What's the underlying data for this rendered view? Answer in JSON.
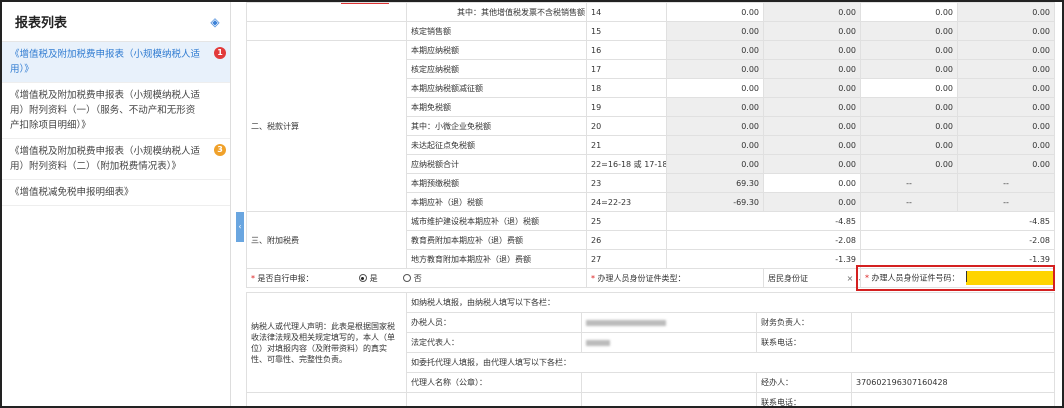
{
  "sidebar": {
    "title": "报表列表",
    "items": [
      {
        "label": "《增值税及附加税费申报表（小规模纳税人适用）》",
        "badge": "1",
        "active": true
      },
      {
        "label": "《增值税及附加税费申报表（小规模纳税人适用）附列资料（一）（服务、不动产和无形资产扣除项目明细）》",
        "badge": ""
      },
      {
        "label": "《增值税及附加税费申报表（小规模纳税人适用）附列资料（二）（附加税费情况表）》",
        "badge": "3"
      },
      {
        "label": "《增值税减免税申报明细表》",
        "badge": ""
      }
    ]
  },
  "table": {
    "section_tax": "二、税款计算",
    "section_surcharge": "三、附加税费",
    "rows": [
      {
        "name": "其中：其他增值税发票不含税销售额",
        "no": "14",
        "v1": "0.00",
        "v2": "0.00",
        "v3": "0.00",
        "v4": "0.00"
      },
      {
        "name": "核定销售额",
        "no": "15",
        "v1": "0.00",
        "v2": "0.00",
        "v3": "0.00",
        "v4": "0.00"
      },
      {
        "name": "本期应纳税额",
        "no": "16",
        "v1": "0.00",
        "v2": "0.00",
        "v3": "0.00",
        "v4": "0.00"
      },
      {
        "name": "核定应纳税额",
        "no": "17",
        "v1": "0.00",
        "v2": "0.00",
        "v3": "0.00",
        "v4": "0.00"
      },
      {
        "name": "本期应纳税额减征额",
        "no": "18",
        "v1": "0.00",
        "v2": "0.00",
        "v3": "0.00",
        "v4": "0.00"
      },
      {
        "name": "本期免税额",
        "no": "19",
        "v1": "0.00",
        "v2": "0.00",
        "v3": "0.00",
        "v4": "0.00"
      },
      {
        "name": "其中：小微企业免税额",
        "no": "20",
        "v1": "0.00",
        "v2": "0.00",
        "v3": "0.00",
        "v4": "0.00"
      },
      {
        "name": "未达起征点免税额",
        "no": "21",
        "v1": "0.00",
        "v2": "0.00",
        "v3": "0.00",
        "v4": "0.00"
      },
      {
        "name": "应纳税额合计",
        "no": "22=16-18 或 17-18",
        "v1": "0.00",
        "v2": "0.00",
        "v3": "0.00",
        "v4": "0.00"
      },
      {
        "name": "本期预缴税额",
        "no": "23",
        "v1": "69.30",
        "v2": "0.00",
        "v3": "--",
        "v4": "--"
      },
      {
        "name": "本期应补（退）税额",
        "no": "24=22-23",
        "v1": "-69.30",
        "v2": "0.00",
        "v3": "--",
        "v4": "--"
      }
    ],
    "surcharge_rows": [
      {
        "name": "城市维护建设税本期应补（退）税额",
        "no": "25",
        "v_left": "-4.85",
        "v_right": "-4.85"
      },
      {
        "name": "教育费附加本期应补（退）费额",
        "no": "26",
        "v_left": "-2.08",
        "v_right": "-2.08"
      },
      {
        "name": "地方教育附加本期应补（退）费额",
        "no": "27",
        "v_left": "-1.39",
        "v_right": "-1.39"
      }
    ]
  },
  "self_declare": {
    "label": "是否自行申报：",
    "yes": "是",
    "no": "否",
    "id_type_label": "办理人员身份证件类型：",
    "id_type_value": "居民身份证",
    "id_no_label": "办理人员身份证件号码："
  },
  "declaration": {
    "note": "纳税人或代理人声明：此表是根据国家税收法律法规及相关规定填写的，本人（单位）对填报内容（及附带资料）的真实性、可靠性、完整性负责。",
    "taxpayer_fill": "如纳税人填报，由纳税人填写以下各栏：",
    "handler": "办税人员：",
    "finance_head": "财务负责人：",
    "legal_rep": "法定代表人：",
    "phone": "联系电话：",
    "agent_fill": "如委托代理人填报，由代理人填写以下各栏：",
    "agent_name": "代理人名称（公章）：",
    "operator": "经办人：",
    "operator_id": "370602196307160428",
    "phone2": "联系电话："
  }
}
